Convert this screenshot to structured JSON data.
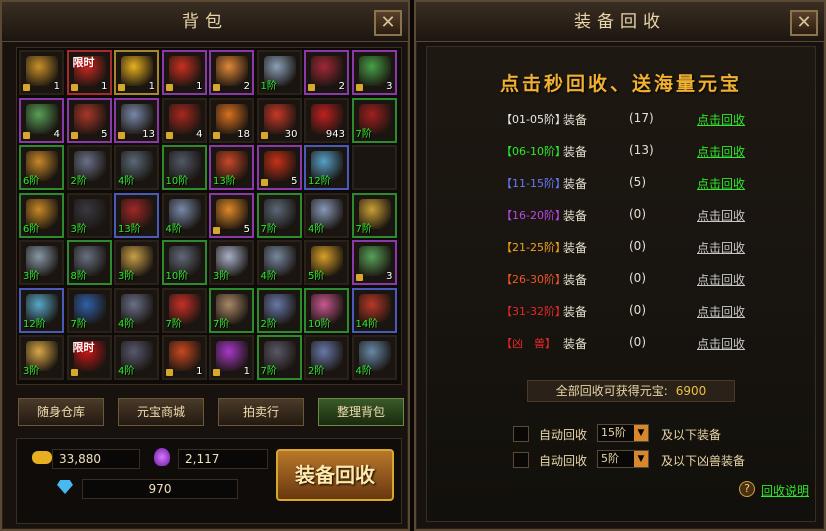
{
  "bag": {
    "title": "背包",
    "close": "✕",
    "items": [
      {
        "c": "",
        "f": "#c8902a",
        "n": "1",
        "l": true,
        "lv": ""
      },
      {
        "c": "r",
        "f": "#c82a20",
        "n": "1",
        "l": true,
        "lv": "",
        "t": "限时"
      },
      {
        "c": "y",
        "f": "#e8b020",
        "n": "1",
        "l": true,
        "lv": ""
      },
      {
        "c": "p",
        "f": "#c83020",
        "n": "1",
        "l": true,
        "lv": ""
      },
      {
        "c": "p",
        "f": "#e08838",
        "n": "2",
        "l": true,
        "lv": ""
      },
      {
        "c": "",
        "f": "#8aa0b8",
        "n": "",
        "l": false,
        "lv": "1阶"
      },
      {
        "c": "p",
        "f": "#a02838",
        "n": "2",
        "l": true,
        "lv": ""
      },
      {
        "c": "p",
        "f": "#48a048",
        "n": "3",
        "l": true,
        "lv": ""
      },
      {
        "c": "p",
        "f": "#58a058",
        "n": "4",
        "l": true,
        "lv": ""
      },
      {
        "c": "p",
        "f": "#a83828",
        "n": "5",
        "l": true,
        "lv": ""
      },
      {
        "c": "p",
        "f": "#7888a8",
        "n": "13",
        "l": true,
        "lv": ""
      },
      {
        "c": "",
        "f": "#a82820",
        "n": "4",
        "l": true,
        "lv": ""
      },
      {
        "c": "",
        "f": "#d87020",
        "n": "18",
        "l": true,
        "lv": ""
      },
      {
        "c": "",
        "f": "#c83828",
        "n": "30",
        "l": true,
        "lv": ""
      },
      {
        "c": "",
        "f": "#c02020",
        "n": "943",
        "l": false,
        "lv": ""
      },
      {
        "c": "g",
        "f": "#a02020",
        "n": "",
        "l": false,
        "lv": "7阶"
      },
      {
        "c": "g",
        "f": "#c8882a",
        "n": "",
        "l": false,
        "lv": "6阶"
      },
      {
        "c": "",
        "f": "#6a7088",
        "n": "",
        "l": false,
        "lv": "2阶"
      },
      {
        "c": "",
        "f": "#5a6878",
        "n": "",
        "l": false,
        "lv": "4阶"
      },
      {
        "c": "g",
        "f": "#505868",
        "n": "",
        "l": false,
        "lv": "10阶"
      },
      {
        "c": "p",
        "f": "#c84828",
        "n": "",
        "l": false,
        "lv": "13阶"
      },
      {
        "c": "p",
        "f": "#c83018",
        "n": "5",
        "l": true,
        "lv": ""
      },
      {
        "c": "b",
        "f": "#58a0c8",
        "n": "",
        "l": false,
        "lv": "12阶"
      },
      {
        "c": "",
        "f": "#1a1510",
        "n": "",
        "l": false,
        "lv": ""
      },
      {
        "c": "g",
        "f": "#c88828",
        "n": "",
        "l": false,
        "lv": "6阶"
      },
      {
        "c": "",
        "f": "#3a3840",
        "n": "",
        "l": false,
        "lv": "3阶"
      },
      {
        "c": "b",
        "f": "#a02828",
        "n": "",
        "l": false,
        "lv": "13阶"
      },
      {
        "c": "",
        "f": "#7888a8",
        "n": "",
        "l": false,
        "lv": "4阶"
      },
      {
        "c": "p",
        "f": "#e08828",
        "n": "5",
        "l": true,
        "lv": ""
      },
      {
        "c": "g",
        "f": "#5a6878",
        "n": "",
        "l": false,
        "lv": "7阶"
      },
      {
        "c": "",
        "f": "#8898b8",
        "n": "",
        "l": false,
        "lv": "4阶"
      },
      {
        "c": "g",
        "f": "#c8a038",
        "n": "",
        "l": false,
        "lv": "7阶"
      },
      {
        "c": "",
        "f": "#8898a8",
        "n": "",
        "l": false,
        "lv": "3阶"
      },
      {
        "c": "g",
        "f": "#687080",
        "n": "",
        "l": false,
        "lv": "8阶"
      },
      {
        "c": "",
        "f": "#c8a048",
        "n": "",
        "l": false,
        "lv": "3阶"
      },
      {
        "c": "g",
        "f": "#606878",
        "n": "",
        "l": false,
        "lv": "10阶"
      },
      {
        "c": "",
        "f": "#a8b0c8",
        "n": "",
        "l": false,
        "lv": "3阶"
      },
      {
        "c": "",
        "f": "#7888a0",
        "n": "",
        "l": false,
        "lv": "4阶"
      },
      {
        "c": "",
        "f": "#d8a028",
        "n": "",
        "l": false,
        "lv": "5阶"
      },
      {
        "c": "p",
        "f": "#58a058",
        "n": "3",
        "l": true,
        "lv": ""
      },
      {
        "c": "b",
        "f": "#58a8c8",
        "n": "",
        "l": false,
        "lv": "12阶"
      },
      {
        "c": "",
        "f": "#3060a8",
        "n": "",
        "l": false,
        "lv": "7阶"
      },
      {
        "c": "",
        "f": "#6a7088",
        "n": "",
        "l": false,
        "lv": "4阶"
      },
      {
        "c": "",
        "f": "#c83028",
        "n": "",
        "l": false,
        "lv": "7阶"
      },
      {
        "c": "g",
        "f": "#a88868",
        "n": "",
        "l": false,
        "lv": "7阶"
      },
      {
        "c": "g",
        "f": "#6878a8",
        "n": "",
        "l": false,
        "lv": "2阶"
      },
      {
        "c": "g",
        "f": "#c85890",
        "n": "",
        "l": false,
        "lv": "10阶"
      },
      {
        "c": "b",
        "f": "#b83828",
        "n": "",
        "l": false,
        "lv": "14阶"
      },
      {
        "c": "",
        "f": "#d8a848",
        "n": "",
        "l": false,
        "lv": "3阶"
      },
      {
        "c": "",
        "f": "#c81818",
        "n": "",
        "l": true,
        "lv": "",
        "t": "限时"
      },
      {
        "c": "",
        "f": "#585870",
        "n": "",
        "l": false,
        "lv": "4阶"
      },
      {
        "c": "",
        "f": "#c84820",
        "n": "1",
        "l": true,
        "lv": ""
      },
      {
        "c": "",
        "f": "#a838c8",
        "n": "1",
        "l": true,
        "lv": ""
      },
      {
        "c": "g",
        "f": "#5a5868",
        "n": "",
        "l": false,
        "lv": "7阶"
      },
      {
        "c": "",
        "f": "#6878a8",
        "n": "",
        "l": false,
        "lv": "2阶"
      },
      {
        "c": "",
        "f": "#6888a8",
        "n": "",
        "l": false,
        "lv": "4阶"
      }
    ],
    "buttons": [
      "随身仓库",
      "元宝商城",
      "拍卖行",
      "整理背包"
    ],
    "gold": "33,880",
    "soul": "2,117",
    "diamond": "970",
    "recycle_btn": "装备回收"
  },
  "recycle": {
    "title": "装备回收",
    "close": "✕",
    "slogan": "点击秒回收、送海量元宝",
    "rows": [
      {
        "range": "【01-05阶】",
        "color": "#e8e8e8",
        "type": "装备",
        "count": "(17)",
        "link": "点击回收",
        "lc": "#2ee82e"
      },
      {
        "range": "【06-10阶】",
        "color": "#2ee82e",
        "type": "装备",
        "count": "(13)",
        "link": "点击回收",
        "lc": "#2ee82e"
      },
      {
        "range": "【11-15阶】",
        "color": "#6878f8",
        "type": "装备",
        "count": "(5)",
        "link": "点击回收",
        "lc": "#2ee82e"
      },
      {
        "range": "【16-20阶】",
        "color": "#b848e8",
        "type": "装备",
        "count": "(0)",
        "link": "点击回收",
        "lc": "#c8c8c8"
      },
      {
        "range": "【21-25阶】",
        "color": "#f0a020",
        "type": "装备",
        "count": "(0)",
        "link": "点击回收",
        "lc": "#c8c8c8"
      },
      {
        "range": "【26-30阶】",
        "color": "#f05828",
        "type": "装备",
        "count": "(0)",
        "link": "点击回收",
        "lc": "#c8c8c8"
      },
      {
        "range": "【31-32阶】",
        "color": "#e82828",
        "type": "装备",
        "count": "(0)",
        "link": "点击回收",
        "lc": "#c8c8c8"
      },
      {
        "range": "【凶　兽】",
        "color": "#e82828",
        "type": "装备",
        "count": "(0)",
        "link": "点击回收",
        "lc": "#c8c8c8"
      }
    ],
    "total_label": "全部回收可获得元宝:",
    "total_value": "6900",
    "auto1": {
      "label": "自动回收",
      "select": "15阶",
      "suffix": "及以下装备"
    },
    "auto2": {
      "label": "自动回收",
      "select": "5阶",
      "suffix": "及以下凶兽装备"
    },
    "help": "回收说明",
    "help_icon": "?"
  }
}
